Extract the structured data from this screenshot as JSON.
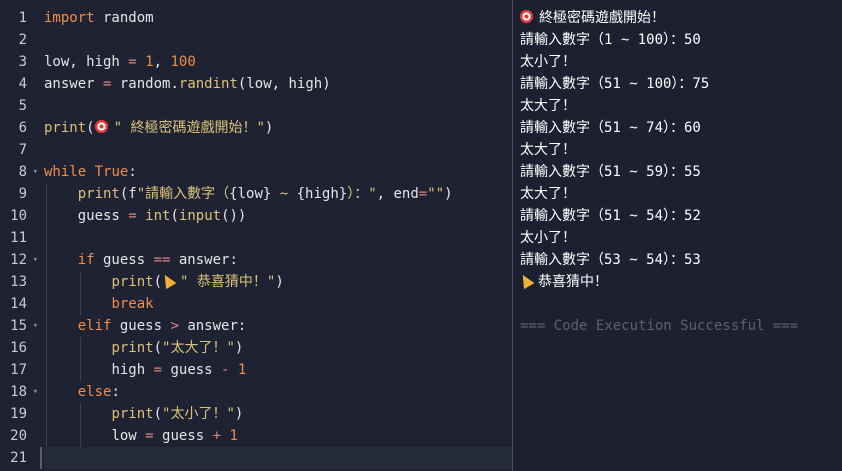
{
  "editor": {
    "line_numbers": [
      "1",
      "2",
      "3",
      "4",
      "5",
      "6",
      "7",
      "8",
      "9",
      "10",
      "11",
      "12",
      "13",
      "14",
      "15",
      "16",
      "17",
      "18",
      "19",
      "20",
      "21"
    ],
    "code": {
      "l1_import": "import",
      "l1_rest": " random",
      "l3_a": "low, high ",
      "l3_eq": "=",
      "l3_sp": " ",
      "l3_n1": "1",
      "l3_comma": ", ",
      "l3_n2": "100",
      "l4_a": "answer ",
      "l4_eq": "=",
      "l4_b": " random.",
      "l4_fn": "randint",
      "l4_c": "(low, high)",
      "l6_fn": "print",
      "l6_p": "(",
      "l6_str": "\" 終極密碼遊戲開始！\"",
      "l6_close": ")",
      "l8_kw": "while",
      "l8_sp": " ",
      "l8_true": "True",
      "l8_colon": ":",
      "l9_fn": "print",
      "l9_a": "(f",
      "l9_s1": "\"請輸入數字（",
      "l9_b": "{low}",
      "l9_s2": " ~ ",
      "l9_c": "{high}",
      "l9_s3": "）：\"",
      "l9_d": ", end",
      "l9_eq": "=",
      "l9_s4": "\"\"",
      "l9_close": ")",
      "l10_a": "guess ",
      "l10_eq": "=",
      "l10_sp": " ",
      "l10_fn1": "int",
      "l10_p": "(",
      "l10_fn2": "input",
      "l10_close": "())",
      "l12_kw": "if",
      "l12_a": " guess ",
      "l12_op": "==",
      "l12_b": " answer:",
      "l13_fn": "print",
      "l13_p": "(",
      "l13_str": "\" 恭喜猜中！\"",
      "l13_close": ")",
      "l14_kw": "break",
      "l15_kw": "elif",
      "l15_a": " guess ",
      "l15_op": ">",
      "l15_b": " answer:",
      "l16_fn": "print",
      "l16_p": "(",
      "l16_str": "\"太大了！\"",
      "l16_close": ")",
      "l17_a": "high ",
      "l17_eq": "=",
      "l17_b": " guess ",
      "l17_op": "-",
      "l17_sp": " ",
      "l17_n": "1",
      "l18_kw": "else",
      "l18_colon": ":",
      "l19_fn": "print",
      "l19_p": "(",
      "l19_str": "\"太小了！\"",
      "l19_close": ")",
      "l20_a": "low ",
      "l20_eq": "=",
      "l20_b": " guess ",
      "l20_op": "+",
      "l20_sp": " ",
      "l20_n": "1"
    }
  },
  "output": {
    "lines": [
      "終極密碼遊戲開始！",
      "請輸入數字（1 ~ 100）：50",
      "太小了！",
      "請輸入數字（51 ~ 100）：75",
      "太大了！",
      "請輸入數字（51 ~ 74）：60",
      "太大了！",
      "請輸入數字（51 ~ 59）：55",
      "太大了！",
      "請輸入數字（51 ~ 54）：52",
      "太小了！",
      "請輸入數字（53 ~ 54）：53",
      "恭喜猜中！",
      "",
      "=== Code Execution Successful ==="
    ]
  },
  "colors": {
    "background": "#1c2030",
    "keyword": "#f08d49",
    "string": "#dbc27a",
    "operator": "#e0857e",
    "success": "#5c6272"
  },
  "icons": {
    "start": "dart-target-icon",
    "win": "party-popper-icon"
  }
}
